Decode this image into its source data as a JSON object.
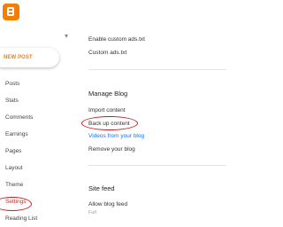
{
  "sidebar": {
    "new_post_label": "NEW POST",
    "items": [
      {
        "label": "Posts"
      },
      {
        "label": "Stats"
      },
      {
        "label": "Comments"
      },
      {
        "label": "Earnings"
      },
      {
        "label": "Pages"
      },
      {
        "label": "Layout"
      },
      {
        "label": "Theme"
      },
      {
        "label": "Settings"
      },
      {
        "label": "Reading List"
      }
    ],
    "active_item": "Settings"
  },
  "main": {
    "ads": {
      "enable_custom_ads_txt": "Enable custom ads.txt",
      "custom_ads_txt": "Custom ads.txt"
    },
    "manage_blog": {
      "heading": "Manage Blog",
      "import_content": "Import content",
      "back_up_content": "Back up content",
      "videos_from_your_blog": "Videos from your blog",
      "remove_your_blog": "Remove your blog"
    },
    "site_feed": {
      "heading": "Site feed",
      "allow_blog_feed": "Allow blog feed",
      "allow_blog_feed_value": "Full"
    }
  },
  "colors": {
    "brand": "#f57d00",
    "link": "#1a73e8",
    "annotation": "#d21920",
    "active_nav": "#c6281a"
  },
  "icons": {
    "logo": "blogger-logo-icon",
    "account_menu": "chevron-down-icon"
  }
}
